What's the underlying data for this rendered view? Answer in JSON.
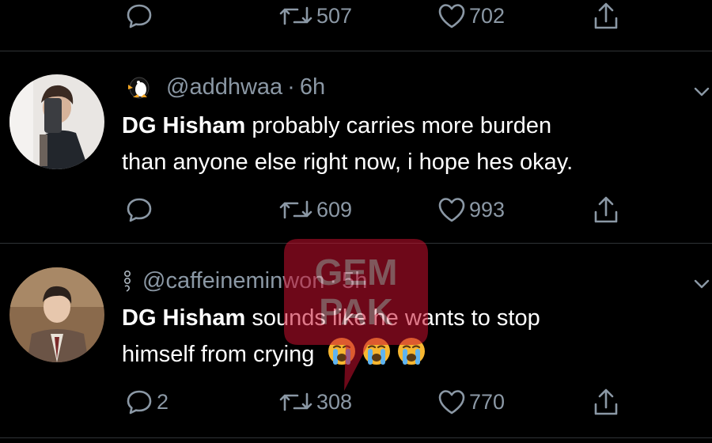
{
  "top_actions": {
    "reply_count": "",
    "retweet_count": "507",
    "like_count": "702"
  },
  "tweets": [
    {
      "handle": "@addhwaa",
      "separator": "·",
      "time": "6h",
      "name_emoji": "penguin",
      "bold": "DG Hisham",
      "text_line1": " probably carries more burden",
      "text_line2": "than anyone else right now, i hope hes okay.",
      "reply_count": "",
      "retweet_count": "609",
      "like_count": "993"
    },
    {
      "handle": "@caffeineminwon",
      "separator": "·",
      "time": "5h",
      "name_emoji": "dots-nine",
      "bold": "DG Hisham",
      "text_line1": " sounds like he wants to stop",
      "text_line2": "himself from crying",
      "trailing_emoji": [
        "crying-face",
        "crying-face",
        "crying-face"
      ],
      "reply_count": "2",
      "retweet_count": "308",
      "like_count": "770"
    }
  ],
  "watermark": {
    "line1": "GEM",
    "line2": "PAK"
  },
  "colors": {
    "background": "#000000",
    "muted": "#8b98a5",
    "divider": "#2f3336",
    "watermark": "#c8102e"
  }
}
